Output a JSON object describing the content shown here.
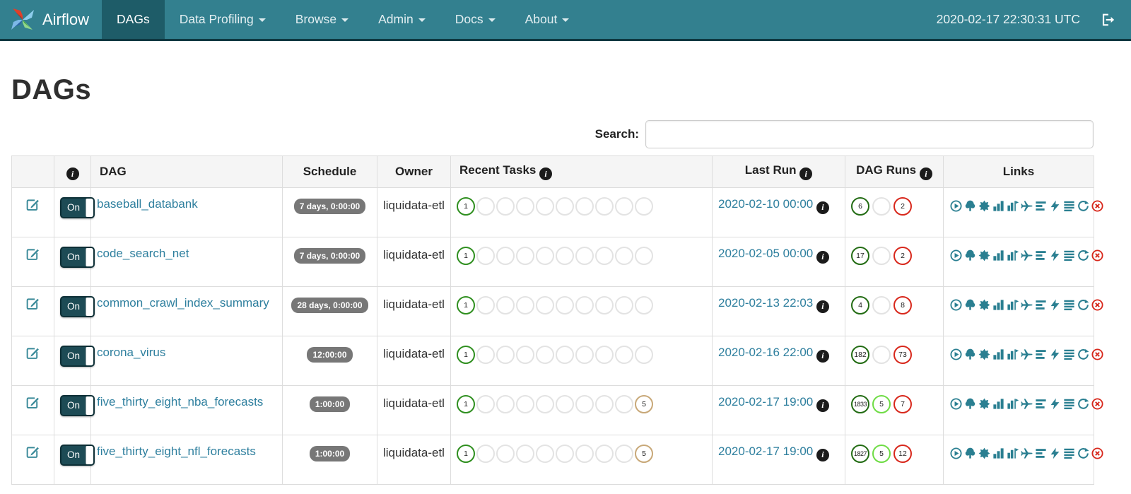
{
  "navbar": {
    "brand": "Airflow",
    "items": [
      {
        "label": "DAGs",
        "active": true,
        "caret": false
      },
      {
        "label": "Data Profiling",
        "active": false,
        "caret": true
      },
      {
        "label": "Browse",
        "active": false,
        "caret": true
      },
      {
        "label": "Admin",
        "active": false,
        "caret": true
      },
      {
        "label": "Docs",
        "active": false,
        "caret": true
      },
      {
        "label": "About",
        "active": false,
        "caret": true
      }
    ],
    "clock": "2020-02-17 22:30:31 UTC"
  },
  "page": {
    "title": "DAGs",
    "search_label": "Search:",
    "search_value": ""
  },
  "colors": {
    "navbar": "#33808f",
    "navbar_active": "#1e5c68",
    "link": "#2e7f9e",
    "icon_teal": "#2a7f91",
    "state_colors": {
      "success": "#2f8f1f",
      "none": "#e3e3e3",
      "scheduled": "#c8a878",
      "dagrun_success": "#236c14",
      "running": "#6fdc45",
      "failed": "#d8281c"
    }
  },
  "table": {
    "headers": [
      {
        "label": "",
        "info": false,
        "cls": "c-edit"
      },
      {
        "label": "",
        "info": true,
        "cls": "c-tog"
      },
      {
        "label": "DAG",
        "info": false,
        "cls": "c-dag h-dag"
      },
      {
        "label": "Schedule",
        "info": false,
        "cls": "c-sched"
      },
      {
        "label": "Owner",
        "info": false,
        "cls": "c-owner"
      },
      {
        "label": "Recent Tasks",
        "info": true,
        "cls": "c-recent h-dag"
      },
      {
        "label": "Last Run",
        "info": true,
        "cls": "c-last"
      },
      {
        "label": "DAG Runs",
        "info": true,
        "cls": "c-runs"
      },
      {
        "label": "Links",
        "info": false,
        "cls": "c-links"
      }
    ],
    "toggle_on_label": "On",
    "link_icons": [
      {
        "id": "trigger",
        "name": "trigger-dag-icon"
      },
      {
        "id": "tree",
        "name": "tree-view-icon"
      },
      {
        "id": "graph",
        "name": "graph-view-icon"
      },
      {
        "id": "duration",
        "name": "task-duration-icon"
      },
      {
        "id": "tries",
        "name": "task-tries-icon"
      },
      {
        "id": "landing",
        "name": "landing-times-icon"
      },
      {
        "id": "gantt",
        "name": "gantt-view-icon"
      },
      {
        "id": "code",
        "name": "code-view-icon"
      },
      {
        "id": "details",
        "name": "dag-details-icon"
      },
      {
        "id": "refresh",
        "name": "refresh-icon"
      },
      {
        "id": "delete",
        "name": "delete-dag-icon",
        "red": true
      }
    ],
    "rows": [
      {
        "dag": "baseball_databank",
        "schedule": "7 days, 0:00:00",
        "owner": "liquidata-etl",
        "recent_tasks": [
          {
            "count": "1",
            "state": "success"
          },
          {
            "count": "",
            "state": "none"
          },
          {
            "count": "",
            "state": "none"
          },
          {
            "count": "",
            "state": "none"
          },
          {
            "count": "",
            "state": "none"
          },
          {
            "count": "",
            "state": "none"
          },
          {
            "count": "",
            "state": "none"
          },
          {
            "count": "",
            "state": "none"
          },
          {
            "count": "",
            "state": "none"
          },
          {
            "count": "",
            "state": "none"
          }
        ],
        "last_run": "2020-02-10 00:00",
        "dag_runs": [
          {
            "count": "6",
            "state": "dagrun_success"
          },
          {
            "count": "",
            "state": "none"
          },
          {
            "count": "2",
            "state": "failed"
          }
        ]
      },
      {
        "dag": "code_search_net",
        "schedule": "7 days, 0:00:00",
        "owner": "liquidata-etl",
        "recent_tasks": [
          {
            "count": "1",
            "state": "success"
          },
          {
            "count": "",
            "state": "none"
          },
          {
            "count": "",
            "state": "none"
          },
          {
            "count": "",
            "state": "none"
          },
          {
            "count": "",
            "state": "none"
          },
          {
            "count": "",
            "state": "none"
          },
          {
            "count": "",
            "state": "none"
          },
          {
            "count": "",
            "state": "none"
          },
          {
            "count": "",
            "state": "none"
          },
          {
            "count": "",
            "state": "none"
          }
        ],
        "last_run": "2020-02-05 00:00",
        "dag_runs": [
          {
            "count": "17",
            "state": "dagrun_success"
          },
          {
            "count": "",
            "state": "none"
          },
          {
            "count": "2",
            "state": "failed"
          }
        ]
      },
      {
        "dag": "common_crawl_index_summary",
        "schedule": "28 days, 0:00:00",
        "owner": "liquidata-etl",
        "recent_tasks": [
          {
            "count": "1",
            "state": "success"
          },
          {
            "count": "",
            "state": "none"
          },
          {
            "count": "",
            "state": "none"
          },
          {
            "count": "",
            "state": "none"
          },
          {
            "count": "",
            "state": "none"
          },
          {
            "count": "",
            "state": "none"
          },
          {
            "count": "",
            "state": "none"
          },
          {
            "count": "",
            "state": "none"
          },
          {
            "count": "",
            "state": "none"
          },
          {
            "count": "",
            "state": "none"
          }
        ],
        "last_run": "2020-02-13 22:03",
        "dag_runs": [
          {
            "count": "4",
            "state": "dagrun_success"
          },
          {
            "count": "",
            "state": "none"
          },
          {
            "count": "8",
            "state": "failed"
          }
        ]
      },
      {
        "dag": "corona_virus",
        "schedule": "12:00:00",
        "owner": "liquidata-etl",
        "recent_tasks": [
          {
            "count": "1",
            "state": "success"
          },
          {
            "count": "",
            "state": "none"
          },
          {
            "count": "",
            "state": "none"
          },
          {
            "count": "",
            "state": "none"
          },
          {
            "count": "",
            "state": "none"
          },
          {
            "count": "",
            "state": "none"
          },
          {
            "count": "",
            "state": "none"
          },
          {
            "count": "",
            "state": "none"
          },
          {
            "count": "",
            "state": "none"
          },
          {
            "count": "",
            "state": "none"
          }
        ],
        "last_run": "2020-02-16 22:00",
        "dag_runs": [
          {
            "count": "182",
            "state": "dagrun_success"
          },
          {
            "count": "",
            "state": "none"
          },
          {
            "count": "73",
            "state": "failed"
          }
        ]
      },
      {
        "dag": "five_thirty_eight_nba_forecasts",
        "schedule": "1:00:00",
        "owner": "liquidata-etl",
        "recent_tasks": [
          {
            "count": "1",
            "state": "success"
          },
          {
            "count": "",
            "state": "none"
          },
          {
            "count": "",
            "state": "none"
          },
          {
            "count": "",
            "state": "none"
          },
          {
            "count": "",
            "state": "none"
          },
          {
            "count": "",
            "state": "none"
          },
          {
            "count": "",
            "state": "none"
          },
          {
            "count": "",
            "state": "none"
          },
          {
            "count": "",
            "state": "none"
          },
          {
            "count": "5",
            "state": "scheduled"
          }
        ],
        "last_run": "2020-02-17 19:00",
        "dag_runs": [
          {
            "count": "1833",
            "state": "dagrun_success"
          },
          {
            "count": "5",
            "state": "running"
          },
          {
            "count": "7",
            "state": "failed"
          }
        ]
      },
      {
        "dag": "five_thirty_eight_nfl_forecasts",
        "schedule": "1:00:00",
        "owner": "liquidata-etl",
        "recent_tasks": [
          {
            "count": "1",
            "state": "success"
          },
          {
            "count": "",
            "state": "none"
          },
          {
            "count": "",
            "state": "none"
          },
          {
            "count": "",
            "state": "none"
          },
          {
            "count": "",
            "state": "none"
          },
          {
            "count": "",
            "state": "none"
          },
          {
            "count": "",
            "state": "none"
          },
          {
            "count": "",
            "state": "none"
          },
          {
            "count": "",
            "state": "none"
          },
          {
            "count": "5",
            "state": "scheduled"
          }
        ],
        "last_run": "2020-02-17 19:00",
        "dag_runs": [
          {
            "count": "1827",
            "state": "dagrun_success"
          },
          {
            "count": "5",
            "state": "running"
          },
          {
            "count": "12",
            "state": "failed"
          }
        ]
      }
    ]
  }
}
